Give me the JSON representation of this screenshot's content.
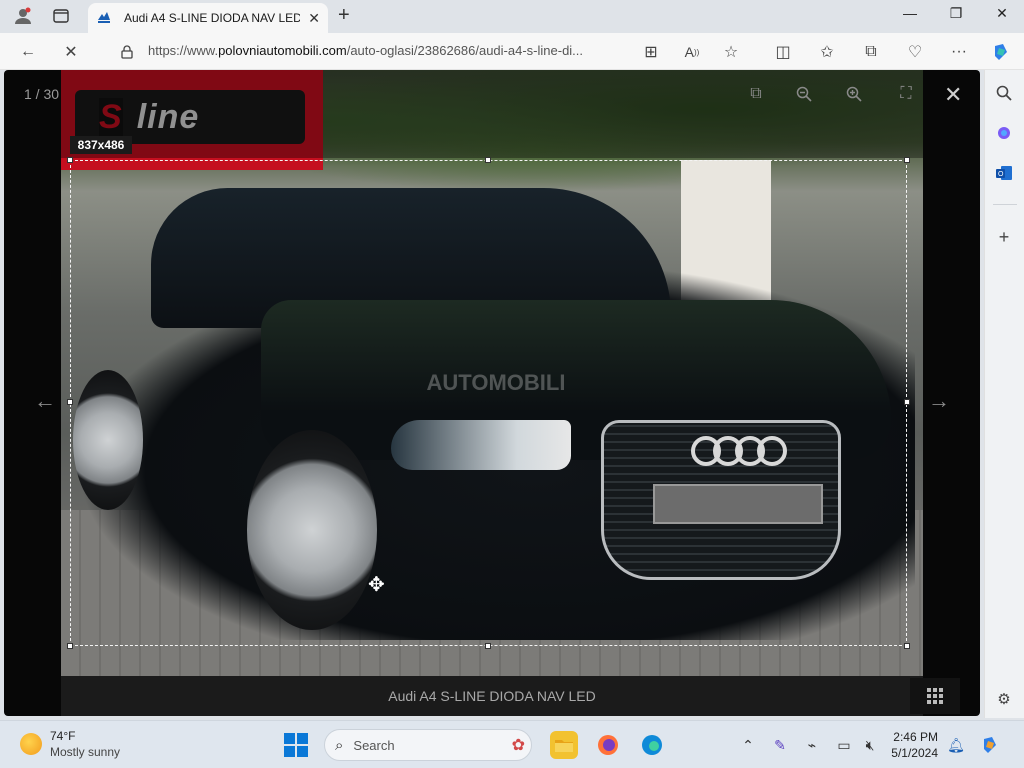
{
  "browser": {
    "tab_title": "Audi A4 S-LINE DIODA NAV LED",
    "url_prefix": "https://www.",
    "url_host": "polovniautomobili.com",
    "url_path": "/auto-oglasi/23862686/audi-a4-s-line-di..."
  },
  "viewer": {
    "counter": "1 / 30",
    "caption": "Audi A4 S-LINE DIODA NAV LED",
    "selection_size": "837x486",
    "sline_text": "line",
    "sline_mark": "S",
    "watermark": "AUTOMOBILI"
  },
  "taskbar": {
    "temperature": "74°F",
    "condition": "Mostly sunny",
    "search_placeholder": "Search",
    "time": "2:46 PM",
    "date": "5/1/2024"
  },
  "icons": {
    "profile": "profile-icon",
    "tabs": "tab-actions-icon",
    "close": "close-icon",
    "back": "back-arrow-icon",
    "stop": "stop-loading-icon",
    "lock": "lock-icon",
    "favorite": "star-icon",
    "copilot": "copilot-icon"
  },
  "colors": {
    "accent": "#0a78d7",
    "sline_red": "#c50f1f",
    "viewer_bg": "#070707"
  }
}
